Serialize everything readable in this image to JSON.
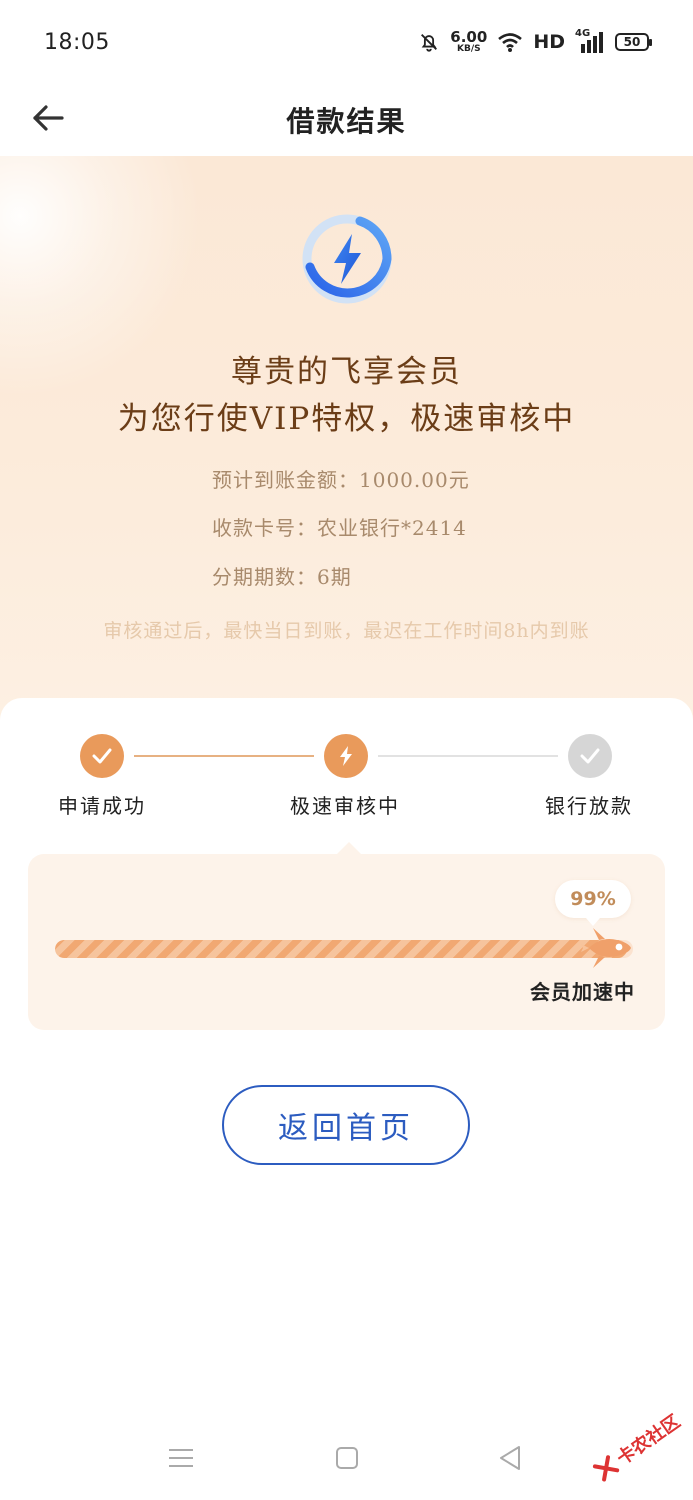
{
  "status_bar": {
    "time": "18:05",
    "net_speed_value": "6.00",
    "net_speed_unit": "KB/S",
    "hd": "HD",
    "network": "4G",
    "battery": "50"
  },
  "nav": {
    "title": "借款结果"
  },
  "hero": {
    "line1": "尊贵的飞享会员",
    "line2": "为您行使VIP特权，极速审核中",
    "rows": [
      {
        "label": "预计到账金额：",
        "value": "1000.00元"
      },
      {
        "label": "收款卡号：",
        "value": "农业银行*2414"
      },
      {
        "label": "分期期数：",
        "value": "6期"
      }
    ],
    "note": "审核通过后，最快当日到账，最迟在工作时间8h内到账"
  },
  "steps": [
    {
      "label": "申请成功",
      "state": "done"
    },
    {
      "label": "极速审核中",
      "state": "active"
    },
    {
      "label": "银行放款",
      "state": "pending"
    }
  ],
  "progress": {
    "percent_label": "99%",
    "fraction": 0.99,
    "status_label": "会员加速中"
  },
  "buttons": {
    "home": "返回首页"
  },
  "watermark": "卡农社区",
  "colors": {
    "accent_orange": "#e99a5b",
    "pending_gray": "#d6d6d6",
    "brand_blue": "#2c5cc0",
    "title_brown": "#6b3d17"
  }
}
